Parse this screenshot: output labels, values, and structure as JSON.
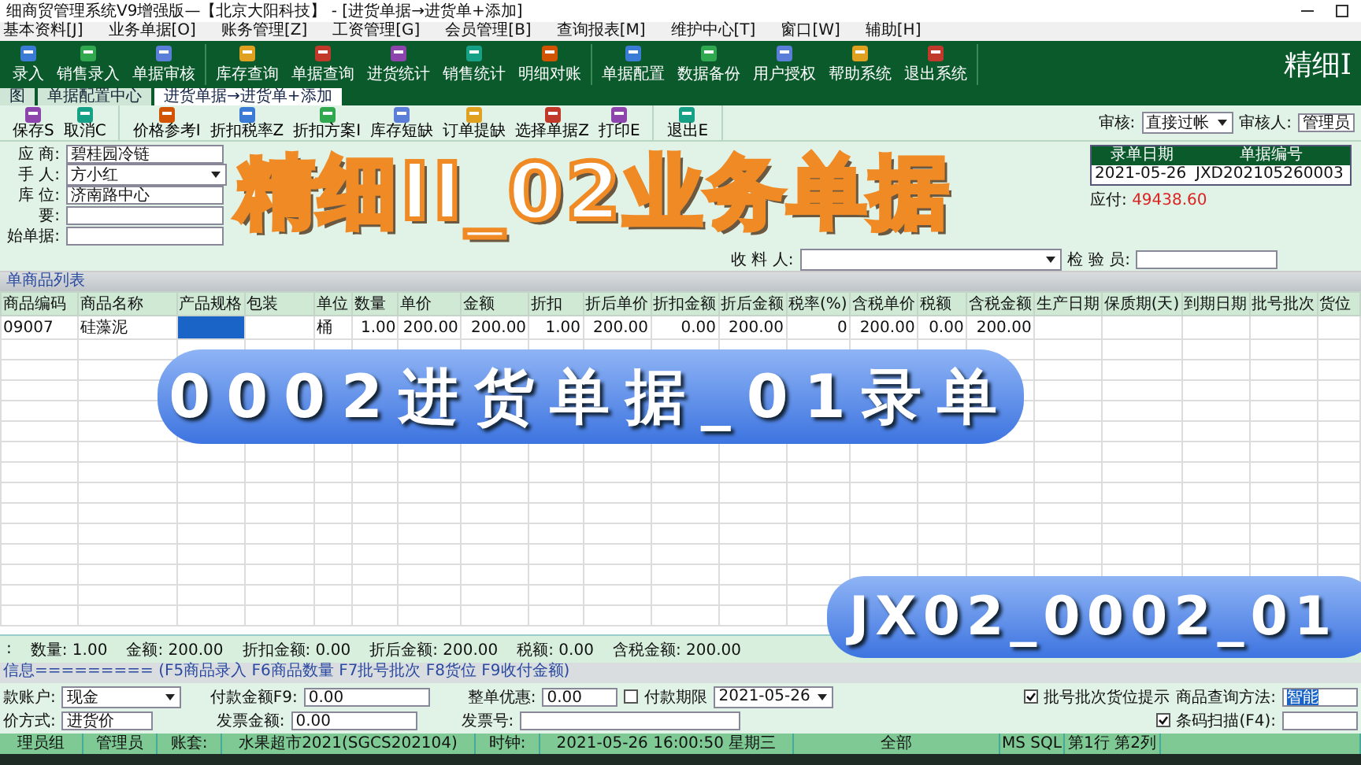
{
  "window": {
    "title": "细商贸管理系统V9增强版—【北京大阳科技】 - [进货单据→进货单+添加]"
  },
  "menu": [
    "基本资料[J]",
    "业务单据[O]",
    "账务管理[Z]",
    "工资管理[G]",
    "会员管理[B]",
    "查询报表[M]",
    "维护中心[T]",
    "窗口[W]",
    "辅助[H]"
  ],
  "toolbar": {
    "groups": [
      [
        "录入",
        "销售录入",
        "单据审核"
      ],
      [
        "库存查询",
        "单据查询",
        "进货统计",
        "销售统计",
        "明细对账"
      ],
      [
        "单据配置",
        "数据备份",
        "用户授权",
        "帮助系统",
        "退出系统"
      ]
    ],
    "brand": "精细I"
  },
  "tabs": [
    {
      "label": "图",
      "selected": false
    },
    {
      "label": "单据配置中心",
      "selected": false
    },
    {
      "label": "进货单据→进货单+添加",
      "selected": true
    }
  ],
  "doc_toolbar": {
    "groups": [
      [
        "保存S",
        "取消C"
      ],
      [
        "价格参考I",
        "折扣税率Z",
        "折扣方案I",
        "库存短缺",
        "订单提缺",
        "选择单据Z",
        "打印E"
      ],
      [
        "退出E"
      ]
    ],
    "audit_label": "审核:",
    "audit_value": "直接过帐",
    "auditor_label": "审核人:",
    "auditor_value": "管理员"
  },
  "form": {
    "fields": [
      {
        "label": "应 商:",
        "value": "碧桂园冷链",
        "dropdown": false
      },
      {
        "label": "手 人:",
        "value": "方小红",
        "dropdown": true
      },
      {
        "label": "库 位:",
        "value": "济南路中心",
        "dropdown": false
      },
      {
        "label": "要:",
        "dropdown": false
      },
      {
        "label": "始单据:",
        "dropdown": false
      }
    ],
    "date_header": "录单日期",
    "number_header": "单据编号",
    "date": "2021-05-26",
    "number": "JXD202105260003",
    "payable_label": "应付:",
    "payable": "49438.60",
    "receiver_label": "收 料 人:",
    "inspector_label": "检 验 员:"
  },
  "section_title": "单商品列表",
  "table": {
    "columns": [
      "商品编码",
      "商品名称",
      "产品规格",
      "包装",
      "单位",
      "数量",
      "单价",
      "金额",
      "折扣",
      "折后单价",
      "折扣金额",
      "折后金额",
      "税率(%)",
      "含税单价",
      "税额",
      "含税金额",
      "生产日期",
      "保质期(天)",
      "到期日期",
      "批号批次",
      "货位"
    ],
    "rows": [
      [
        "09007",
        "硅藻泥",
        "",
        "",
        "桶",
        "1.00",
        "200.00",
        "200.00",
        "1.00",
        "200.00",
        "0.00",
        "200.00",
        "0",
        "200.00",
        "0.00",
        "200.00",
        "",
        "",
        "",
        "",
        ""
      ]
    ]
  },
  "totals": [
    ":",
    "数量: 1.00",
    "金额: 200.00",
    "折扣金额: 0.00",
    "折后金额: 200.00",
    "税额: 0.00",
    "含税金额: 200.00"
  ],
  "info_line": "信息========= (F5商品录入 F6商品数量 F7批号批次 F8货位 F9收付金额)",
  "payment": {
    "account_label": "款账户:",
    "account": "现金",
    "amount_label": "付款金额F9:",
    "amount": "0.00",
    "discount_label": "整单优惠:",
    "discount": "0.00",
    "term_label": "付款期限",
    "term_checked": false,
    "term_date": "2021-05-26",
    "price_label": "价方式:",
    "price": "进货价",
    "invoice_amount_label": "发票金额:",
    "invoice_amount": "0.00",
    "invoice_no_label": "发票号:",
    "batch_hint_label": "批号批次货位提示",
    "batch_hint_checked": true,
    "query_label": "商品查询方法:",
    "query": "智能",
    "barcode_label": "条码扫描(F4):",
    "barcode_checked": true
  },
  "status_bar": [
    "理员组",
    "管理员",
    "账套:",
    "水果超市2021(SGCS202104)",
    "时钟:",
    "2021-05-26 16:00:50 星期三",
    "全部",
    "MS SQL",
    "第1行 第2列"
  ],
  "overlays": [
    {
      "kind": "headline",
      "text": "精细II_02业务单据"
    },
    {
      "kind": "banner",
      "text": "0002进货单据_01录单"
    },
    {
      "kind": "code",
      "text": "JX02_0002_01"
    }
  ]
}
